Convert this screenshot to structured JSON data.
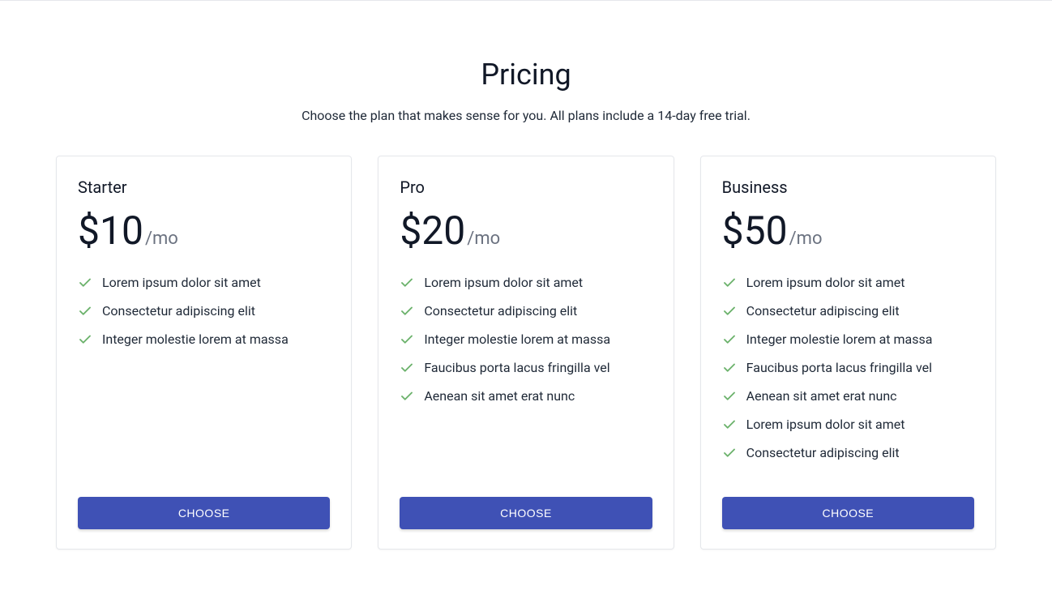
{
  "header": {
    "title": "Pricing",
    "subtitle": "Choose the plan that makes sense for you. All plans include a 14-day free trial."
  },
  "plans": [
    {
      "name": "Starter",
      "price": "$10",
      "period": "/mo",
      "features": [
        "Lorem ipsum dolor sit amet",
        "Consectetur adipiscing elit",
        "Integer molestie lorem at massa"
      ],
      "cta": "CHOOSE"
    },
    {
      "name": "Pro",
      "price": "$20",
      "period": "/mo",
      "features": [
        "Lorem ipsum dolor sit amet",
        "Consectetur adipiscing elit",
        "Integer molestie lorem at massa",
        "Faucibus porta lacus fringilla vel",
        "Aenean sit amet erat nunc"
      ],
      "cta": "CHOOSE"
    },
    {
      "name": "Business",
      "price": "$50",
      "period": "/mo",
      "features": [
        "Lorem ipsum dolor sit amet",
        "Consectetur adipiscing elit",
        "Integer molestie lorem at massa",
        "Faucibus porta lacus fringilla vel",
        "Aenean sit amet erat nunc",
        "Lorem ipsum dolor sit amet",
        "Consectetur adipiscing elit"
      ],
      "cta": "CHOOSE"
    }
  ]
}
